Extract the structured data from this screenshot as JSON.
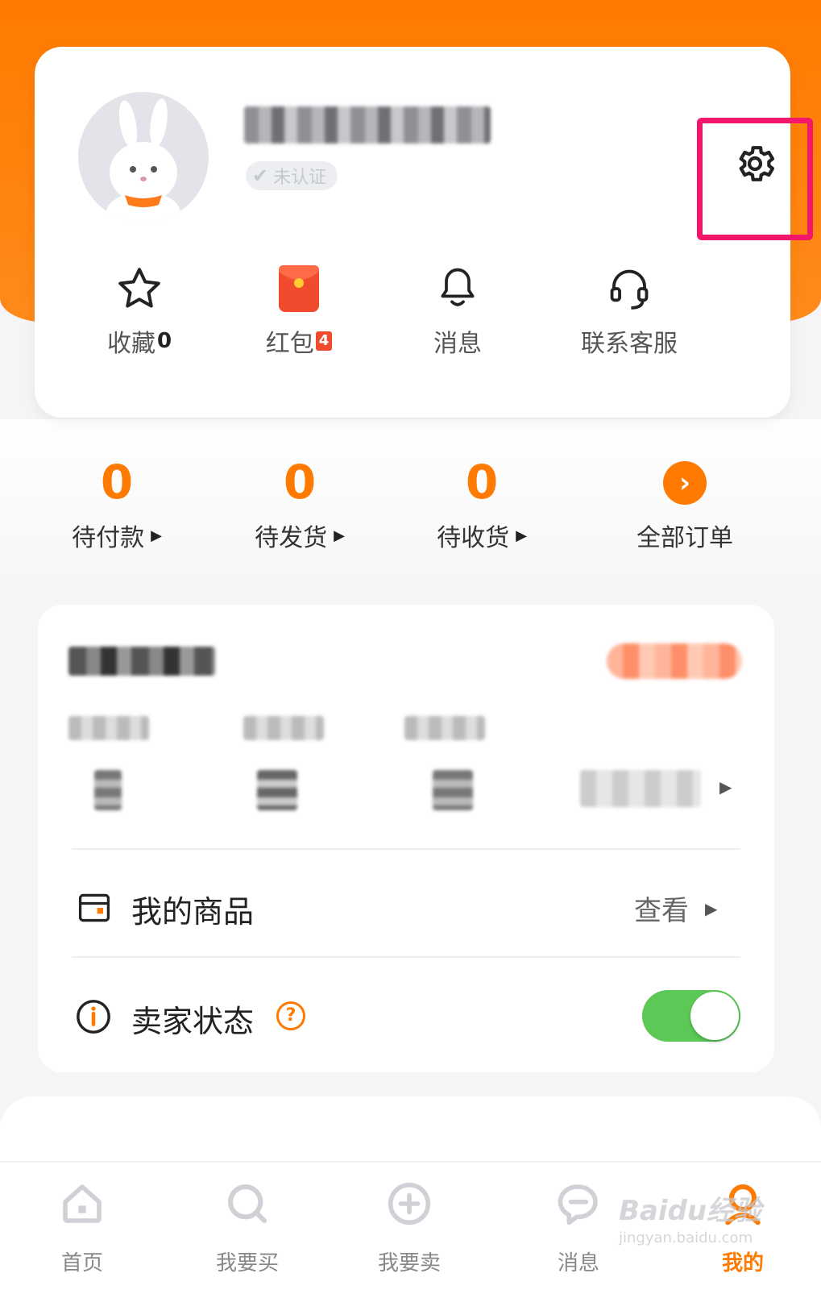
{
  "profile": {
    "verify_badge": "未认证"
  },
  "quick_actions": [
    {
      "label": "收藏",
      "count": "0",
      "icon": "star-icon"
    },
    {
      "label": "红包",
      "badge": "4",
      "icon": "red-envelope-icon"
    },
    {
      "label": "消息",
      "icon": "bell-icon"
    },
    {
      "label": "联系客服",
      "icon": "headset-icon"
    }
  ],
  "orders": [
    {
      "count": "0",
      "label": "待付款"
    },
    {
      "count": "0",
      "label": "待发货"
    },
    {
      "count": "0",
      "label": "待收货"
    },
    {
      "label": "全部订单"
    }
  ],
  "seller": {
    "my_goods_label": "我的商品",
    "my_goods_action": "查看",
    "status_label": "卖家状态",
    "status_help": "?",
    "status_on": true
  },
  "tabbar": [
    {
      "label": "首页",
      "icon": "home-icon"
    },
    {
      "label": "我要买",
      "icon": "search-icon"
    },
    {
      "label": "我要卖",
      "icon": "plus-circle-icon"
    },
    {
      "label": "消息",
      "icon": "chat-icon"
    },
    {
      "label": "我的",
      "icon": "user-icon",
      "active": true
    }
  ],
  "watermark": {
    "brand": "Baidu经验",
    "url": "jingyan.baidu.com"
  },
  "colors": {
    "accent": "#ff7a00",
    "highlight": "#f2176a",
    "toggle_on": "#5cc957"
  }
}
